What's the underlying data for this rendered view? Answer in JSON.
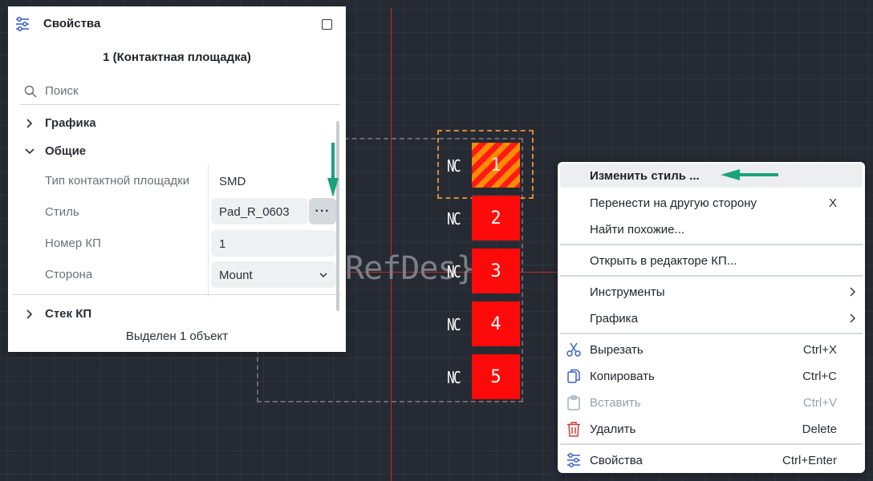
{
  "canvas": {
    "refdes": "RefDes}",
    "pads": [
      {
        "number": "1",
        "net": "NC",
        "selected": true
      },
      {
        "number": "2",
        "net": "NC",
        "selected": false
      },
      {
        "number": "3",
        "net": "NC",
        "selected": false
      },
      {
        "number": "4",
        "net": "NC",
        "selected": false
      },
      {
        "number": "5",
        "net": "NC",
        "selected": false
      }
    ],
    "colors": {
      "pad": "#ff0a0a",
      "selection": "#d6893a",
      "crosshair": "#c12b2b",
      "accent_arrow": "#1aa37a"
    }
  },
  "properties_panel": {
    "title": "Свойства",
    "object_title": "1 (Контактная площадка)",
    "search_placeholder": "Поиск",
    "sections": {
      "graphics": "Графика",
      "general": "Общие",
      "pad_stack": "Стек КП"
    },
    "props": [
      {
        "label": "Тип контактной площадки",
        "value": "SMD"
      },
      {
        "label": "Стиль",
        "value": "Pad_R_0603"
      },
      {
        "label": "Номер КП",
        "value": "1"
      },
      {
        "label": "Сторона",
        "value": "Mount"
      }
    ],
    "dots_label": "···",
    "status": "Выделен 1 объект"
  },
  "context_menu": {
    "items": [
      {
        "label": "Изменить стиль ...",
        "shortcut": ""
      },
      {
        "label": "Перенести на другую сторону",
        "shortcut": "X"
      },
      {
        "label": "Найти похожие...",
        "shortcut": ""
      },
      {
        "label": "Открыть в редакторе КП...",
        "shortcut": ""
      },
      {
        "label": "Инструменты",
        "shortcut": ""
      },
      {
        "label": "Графика",
        "shortcut": ""
      },
      {
        "label": "Вырезать",
        "shortcut": "Ctrl+X"
      },
      {
        "label": "Копировать",
        "shortcut": "Ctrl+C"
      },
      {
        "label": "Вставить",
        "shortcut": "Ctrl+V"
      },
      {
        "label": "Удалить",
        "shortcut": "Delete"
      },
      {
        "label": "Свойства",
        "shortcut": "Ctrl+Enter"
      }
    ]
  }
}
